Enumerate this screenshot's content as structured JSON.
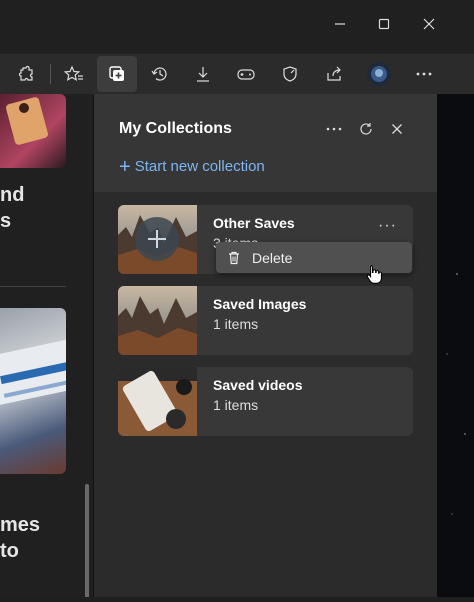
{
  "colors": {
    "accent": "#7cb6f2",
    "panel": "#2b2b2b",
    "header": "#363636",
    "card": "#383838",
    "menu": "#505050"
  },
  "window": {
    "icons": [
      "minimize-icon",
      "maximize-icon",
      "close-icon"
    ]
  },
  "toolbar": {
    "icons": [
      "extensions-icon",
      "favorites-icon",
      "collections-icon",
      "history-icon",
      "downloads-icon",
      "games-icon",
      "browser-essentials-icon",
      "share-icon",
      "profile-avatar",
      "more-icon"
    ]
  },
  "left": {
    "text_top": "nd",
    "text_top2": "s",
    "text_bottom": "mes",
    "text_bottom2": "to"
  },
  "collections": {
    "title": "My Collections",
    "start_new": "Start new collection",
    "items": [
      {
        "title": "Other Saves",
        "count": "3 items"
      },
      {
        "title": "Saved Images",
        "count": "1 items"
      },
      {
        "title": "Saved videos",
        "count": "1 items"
      }
    ],
    "context_menu": {
      "delete_label": "Delete"
    }
  }
}
